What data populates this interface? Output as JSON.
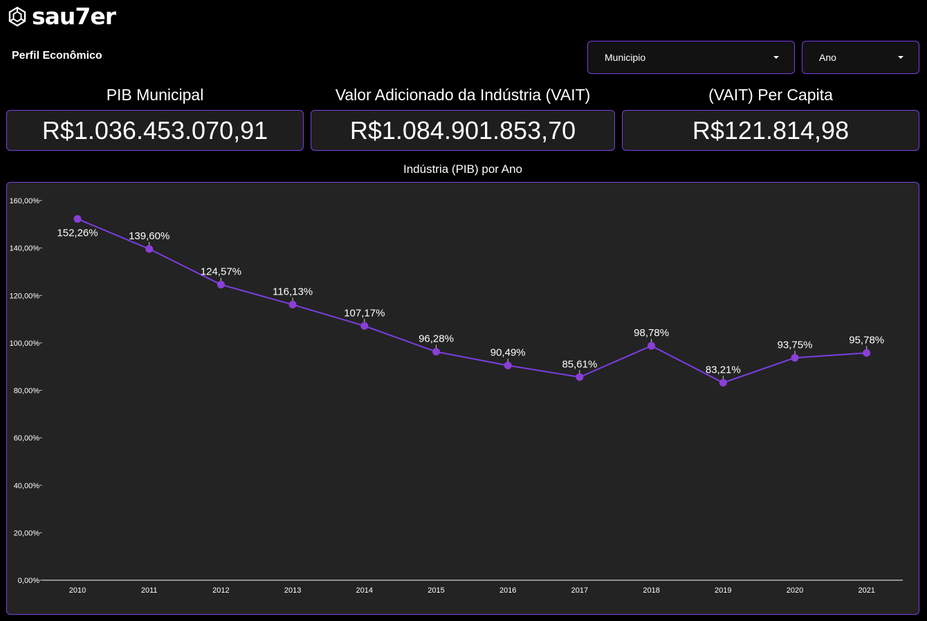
{
  "brand": {
    "logo_text": "sau7er",
    "logo_icon": "hexagon-mark-icon"
  },
  "page": {
    "title": "Perfil Econômico"
  },
  "filters": {
    "municipio": {
      "value": "Municipio",
      "icon": "chevron-down-icon"
    },
    "ano": {
      "value": "Ano",
      "icon": "chevron-down-icon"
    }
  },
  "kpis": [
    {
      "label": "PIB Municipal",
      "value": "R$1.036.453.070,91"
    },
    {
      "label": "Valor Adicionado da Indústria (VAIT)",
      "value": "R$1.084.901.853,70"
    },
    {
      "label": "(VAIT) Per Capita",
      "value": "R$121.814,98"
    }
  ],
  "colors": {
    "accent": "#7b3fe4",
    "line": "#7b3fe4",
    "point": "#8a3fd6",
    "panel": "#232323",
    "background": "#000000"
  },
  "chart_data": {
    "type": "line",
    "title": "Indústria (PIB) por Ano",
    "xlabel": "",
    "ylabel": "",
    "categories": [
      "2010",
      "2011",
      "2012",
      "2013",
      "2014",
      "2015",
      "2016",
      "2017",
      "2018",
      "2019",
      "2020",
      "2021"
    ],
    "series": [
      {
        "values": [
          152.26,
          139.6,
          124.57,
          116.13,
          107.17,
          96.28,
          90.49,
          85.61,
          98.78,
          83.21,
          93.75,
          95.78
        ],
        "labels": [
          "152,26%",
          "139,60%",
          "124,57%",
          "116,13%",
          "107,17%",
          "96,28%",
          "90,49%",
          "85,61%",
          "98,78%",
          "83,21%",
          "93,75%",
          "95,78%"
        ]
      }
    ],
    "ylim": [
      0,
      160
    ],
    "yticks": [
      0,
      20,
      40,
      60,
      80,
      100,
      120,
      140,
      160
    ],
    "ytick_labels": [
      "0,00%",
      "20,00%",
      "40,00%",
      "60,00%",
      "80,00%",
      "100,00%",
      "120,00%",
      "140,00%",
      "160,00%"
    ],
    "grid": false,
    "legend": "none"
  }
}
